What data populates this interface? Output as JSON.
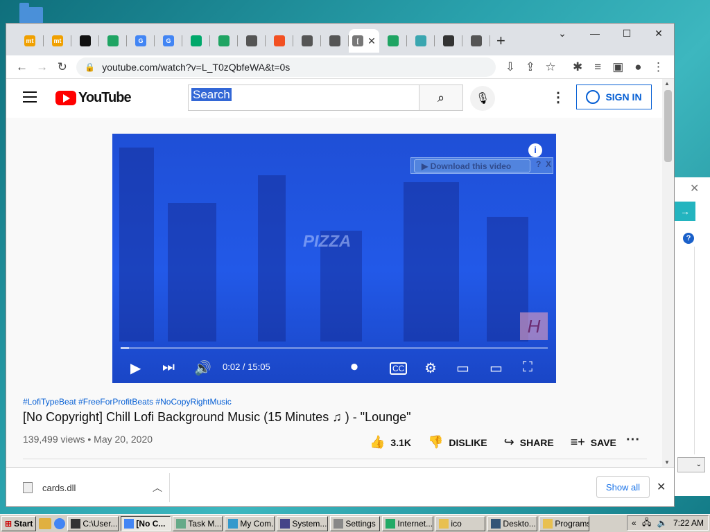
{
  "browser": {
    "tabs": [
      {
        "icon": "mt-icon",
        "label": "mt",
        "color": "#f0a000"
      },
      {
        "icon": "mt-icon",
        "label": "mt",
        "color": "#f0a000"
      },
      {
        "icon": "github-icon",
        "label": "",
        "color": "#111111"
      },
      {
        "icon": "drive-icon",
        "label": "",
        "color": "#1fa463"
      },
      {
        "icon": "google-icon",
        "label": "G",
        "color": "#4285f4"
      },
      {
        "icon": "google-icon",
        "label": "G",
        "color": "#4285f4"
      },
      {
        "icon": "play-store-icon",
        "label": "",
        "color": "#00a86b"
      },
      {
        "icon": "drive-icon",
        "label": "",
        "color": "#1fa463"
      },
      {
        "icon": "globe-icon",
        "label": "",
        "color": "#555555"
      },
      {
        "icon": "microsoft-icon",
        "label": "",
        "color": "#f25022"
      },
      {
        "icon": "globe-icon",
        "label": "",
        "color": "#555555"
      },
      {
        "icon": "globe-icon",
        "label": "",
        "color": "#555555"
      },
      {
        "icon": "page-icon",
        "label": "[",
        "color": "#777777",
        "active": true
      },
      {
        "icon": "drive-icon",
        "label": "",
        "color": "#1fa463"
      },
      {
        "icon": "web-icon",
        "label": "",
        "color": "#3aa6b0"
      },
      {
        "icon": "archive-icon",
        "label": "",
        "color": "#333333"
      },
      {
        "icon": "chrome-icon",
        "label": "",
        "color": "#555555"
      }
    ],
    "active_tab_close": "✕",
    "new_tab": "+",
    "url": "youtube.com/watch?v=L_T0zQbfeWA&t=0s"
  },
  "youtube": {
    "logo_text": "YouTube",
    "search_text": "Search",
    "signin_label": "SIGN IN",
    "video": {
      "download_label": "Download this video",
      "download_help": "?",
      "download_close": "X",
      "overlay_text": "PIZZA",
      "watermark": "H",
      "time": "0:02 / 15:05",
      "progress": 0.02,
      "cc_label": "CC"
    },
    "tags": "#LofiTypeBeat #FreeForProfitBeats #NoCopyRightMusic",
    "title": "[No Copyright] Chill Lofi Background Music (15 Minutes ♫ ) - \"Lounge\"",
    "meta": "139,499 views • May 20, 2020",
    "likes": "3.1K",
    "dislike_label": "DISLIKE",
    "share_label": "SHARE",
    "save_label": "SAVE"
  },
  "downloads": {
    "file": "cards.dll",
    "show_all": "Show all"
  },
  "taskbar": {
    "start": "Start",
    "tasks": [
      "C:\\User...",
      "[No C...",
      "Task M...",
      "My Com...",
      "System...",
      "Settings",
      "Internet...",
      "ico",
      "Deskto...",
      "Programs"
    ],
    "active_index": 1,
    "clock": "7:22 AM",
    "tray_arrow": "«"
  },
  "colors": {
    "accent": "#065fd4",
    "yt_red": "#ff0000",
    "selection": "#3367d6"
  }
}
